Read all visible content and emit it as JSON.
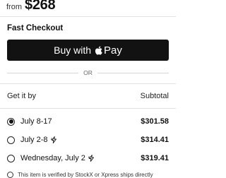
{
  "header": {
    "from_label": "from",
    "price": "$268"
  },
  "fast_checkout": {
    "title": "Fast Checkout",
    "button_prefix": "Buy with",
    "button_suffix": "Pay",
    "button_bg": "#121212"
  },
  "separator": {
    "or_label": "OR"
  },
  "shipping": {
    "get_it_by_label": "Get it by",
    "subtotal_label": "Subtotal",
    "options": [
      {
        "label": "July 8-17",
        "price": "$301.58",
        "selected": true,
        "express": false
      },
      {
        "label": "July 2-8",
        "price": "$314.41",
        "selected": false,
        "express": true,
        "icon": "express-bolt-icon"
      },
      {
        "label": "Wednesday, July 2",
        "price": "$319.41",
        "selected": false,
        "express": true,
        "icon": "express-bolt-icon"
      }
    ]
  },
  "footer": {
    "note": "This item is verified by StockX or Xpress ships directly"
  }
}
